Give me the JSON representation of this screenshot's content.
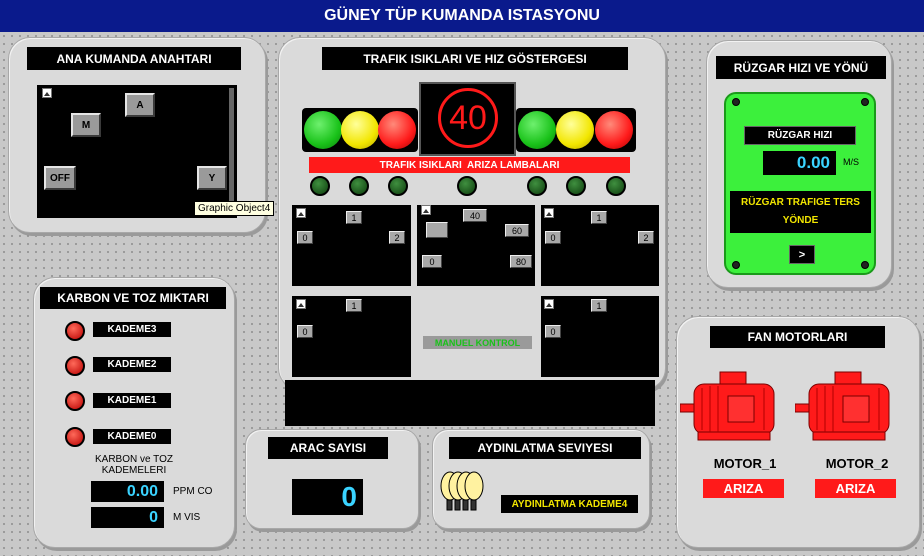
{
  "title": "GÜNEY TÜP KUMANDA ISTASYONU",
  "main_switch": {
    "title": "ANA KUMANDA ANAHTARI",
    "btn_m": "M",
    "btn_a": "A",
    "btn_off": "OFF",
    "btn_y": "Y",
    "tooltip": "Graphic Object4"
  },
  "traffic": {
    "title": "TRAFIK ISIKLARI VE HIZ GÖSTERGESI",
    "speed": "40",
    "fault_banner": "TRAFIK ISIKLARI  ARIZA LAMBALARI",
    "manual": "MANUEL KONTROL",
    "ctrl_left": {
      "one": "1",
      "zero": "0",
      "two": "2"
    },
    "ctrl_right": {
      "one": "1",
      "zero": "0",
      "two": "2"
    },
    "speed_ctrl": {
      "s40": "40",
      "s60": "60",
      "s0": "0",
      "s80": "80"
    },
    "ctrl_bottom_left": {
      "one": "1",
      "zero": "0"
    },
    "ctrl_bottom_right": {
      "one": "1",
      "zero": "0"
    },
    "colors": {
      "green": "#19c219",
      "yellow": "#f2e600",
      "red": "#ff1a1a"
    }
  },
  "wind": {
    "title": "RÜZGAR HIZI  VE YÖNÜ",
    "speed_label": "RÜZGAR HIZI",
    "value": "0.00",
    "unit": "M/S",
    "direction_line1": "RÜZGAR TRAFIGE TERS",
    "direction_line2": "YÖNDE",
    "arrow": ">"
  },
  "carbon": {
    "title": "KARBON VE TOZ MIKTARI",
    "levels": [
      "KADEME3",
      "KADEME2",
      "KADEME1",
      "KADEME0"
    ],
    "caption_line1": "KARBON ve TOZ",
    "caption_line2": "KADEMELERI",
    "ppm_value": "0.00",
    "ppm_unit": "PPM CO",
    "vis_value": "0",
    "vis_unit": "M VIS"
  },
  "vehicles": {
    "title": "ARAC SAYISI",
    "count": "0"
  },
  "lighting": {
    "title": "AYDINLATMA SEVIYESI",
    "level": "AYDINLATMA KADEME4"
  },
  "fans": {
    "title": "FAN MOTORLARI",
    "motors": [
      {
        "name": "MOTOR_1",
        "status": "ARIZA"
      },
      {
        "name": "MOTOR_2",
        "status": "ARIZA"
      }
    ]
  }
}
